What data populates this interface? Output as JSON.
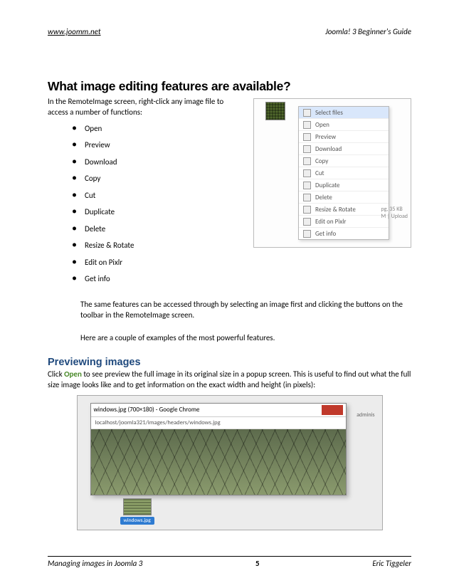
{
  "header": {
    "site_link": "www.joomm.net",
    "doc_title": "Joomla! 3 Beginner's Guide"
  },
  "section1": {
    "heading": "What image editing features are available?",
    "intro": "In the RemoteImage screen, right-click any image file to access a number of functions:",
    "features": [
      "Open",
      "Preview",
      "Download",
      "Copy",
      "Cut",
      "Duplicate",
      "Delete",
      "Resize & Rotate",
      "Edit on Pixlr",
      "Get info"
    ],
    "note1": "The same features can be accessed through by selecting an image first and clicking the buttons on the toolbar in the RemoteImage screen.",
    "note2": "Here are a couple of examples of the most powerful features."
  },
  "context_menu": {
    "items": [
      "Select files",
      "Open",
      "Preview",
      "Download",
      "Copy",
      "Cut",
      "Duplicate",
      "Delete",
      "Resize & Rotate",
      "Edit on Pixlr",
      "Get info"
    ],
    "side_text_1": "pg, 35 KB",
    "side_text_2": "M | Upload"
  },
  "section2": {
    "heading": "Previewing images",
    "body_prefix": "Click ",
    "open_label": "Open",
    "body_suffix": " to see preview the full image in its original size in a popup screen. This is useful to find out what the full size image looks like and to get information on the exact width and height (in pixels):"
  },
  "popup": {
    "title": "windows.jpg (700×180) - Google Chrome",
    "url": "localhost/joomla321/images/headers/windows.jpg",
    "thumb_label": "windows.jpg",
    "side_label": "adminis"
  },
  "footer": {
    "left": "Managing images in Joomla 3",
    "page": "5",
    "right": "Eric Tiggeler"
  }
}
